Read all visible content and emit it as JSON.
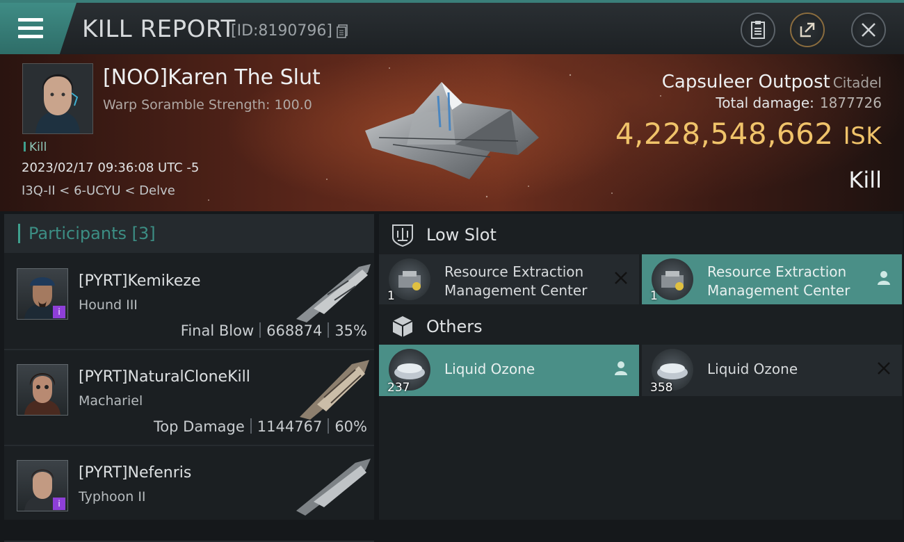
{
  "header": {
    "title": "KILL REPORT",
    "report_id": "[ID:8190796]"
  },
  "victim": {
    "name": "[NOO]Karen The Slut",
    "subtitle": "Warp Soramble Strength: 100.0",
    "tag": "Kill",
    "datetime": "2023/02/17 09:36:08 UTC -5",
    "location": "I3Q-II < 6-UCYU < Delve",
    "ship_name": "Capsuleer Outpost",
    "ship_class": "Citadel",
    "total_damage_label": "Total damage:",
    "total_damage": "1877726",
    "isk_value": "4,228,548,662",
    "isk_unit": "ISK",
    "result": "Kill"
  },
  "participants": {
    "header": "Participants [3]",
    "rows": [
      {
        "name": "[PYRT]Kemikeze",
        "ship": "Hound III",
        "stat_label": "Final Blow",
        "damage": "668874",
        "percent": "35%",
        "badge": true
      },
      {
        "name": "[PYRT]NaturalCloneKill",
        "ship": "Machariel",
        "stat_label": "Top Damage",
        "damage": "1144767",
        "percent": "60%",
        "badge": false
      },
      {
        "name": "[PYRT]Nefenris",
        "ship": "Typhoon II",
        "stat_label": "",
        "damage": "",
        "percent": "",
        "badge": true
      }
    ]
  },
  "low_slot": {
    "title": "Low Slot",
    "items": [
      {
        "line1": "Resource Extraction",
        "line2": "Management Center",
        "qty": "1",
        "state": "destroyed"
      },
      {
        "line1": "Resource Extraction",
        "line2": "Management Center",
        "qty": "1",
        "state": "dropped"
      }
    ]
  },
  "others": {
    "title": "Others",
    "items": [
      {
        "label": "Liquid Ozone",
        "qty": "237",
        "state": "dropped"
      },
      {
        "label": "Liquid Ozone",
        "qty": "358",
        "state": "destroyed"
      }
    ]
  },
  "colors": {
    "accent": "#3fa08e",
    "isk": "#f0c36a",
    "dropped_bg": "#4a8f87",
    "badge": "#8e3fd8"
  }
}
